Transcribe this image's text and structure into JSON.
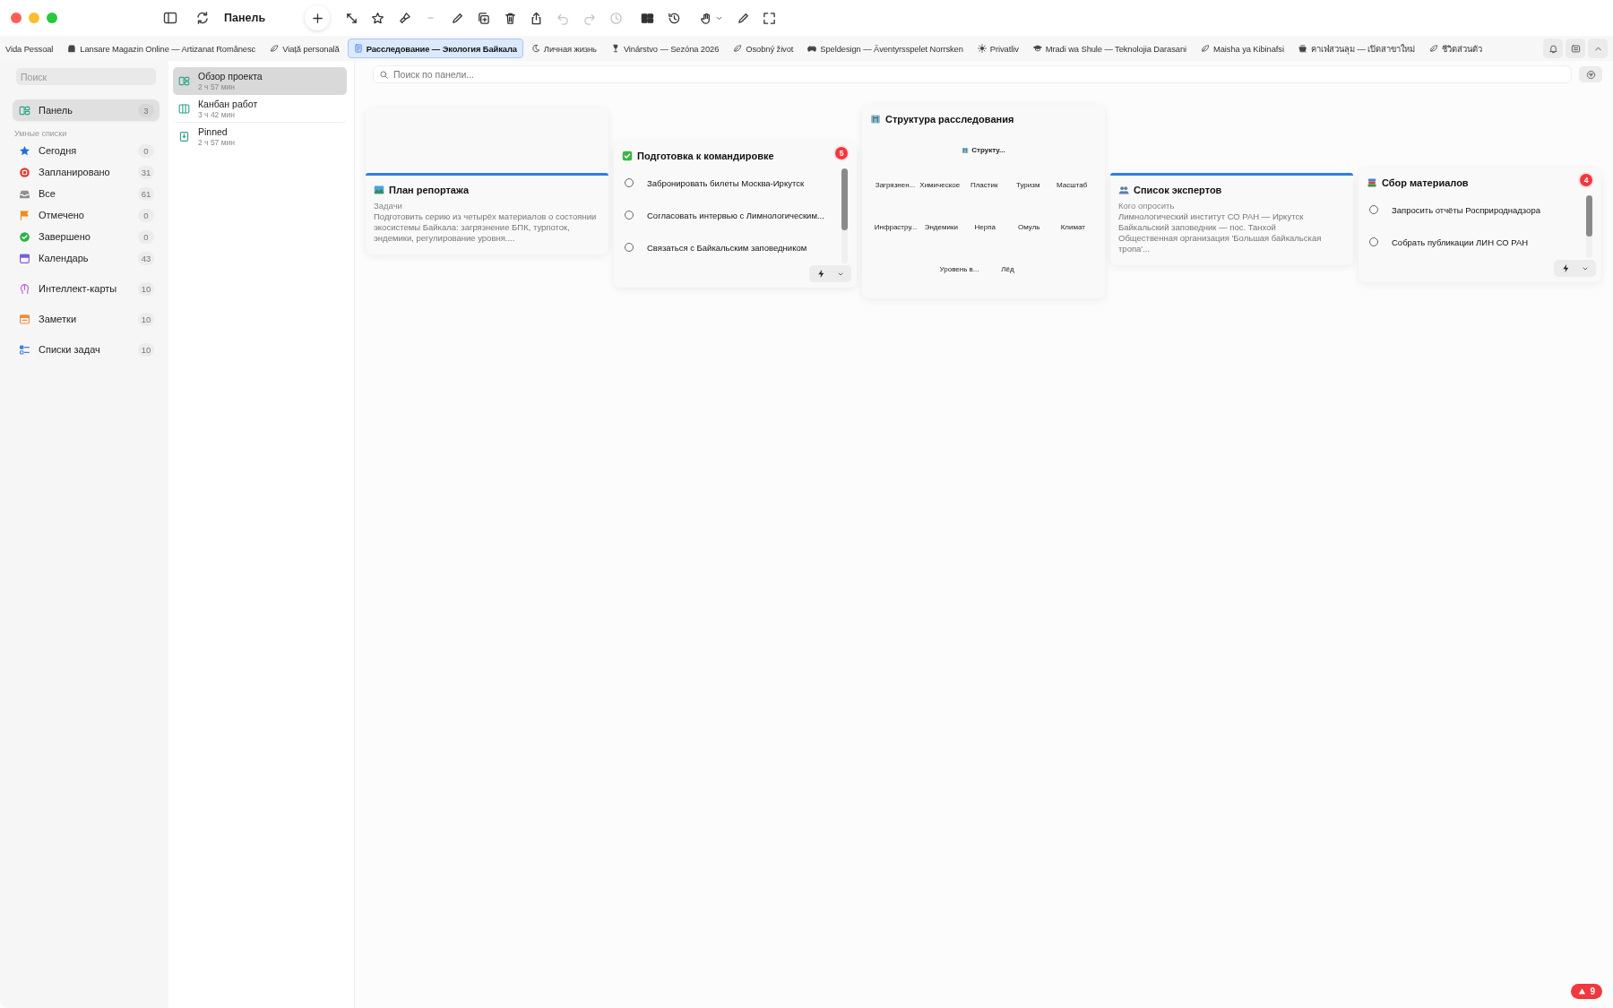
{
  "window": {
    "title": "Панель"
  },
  "toolbar_buttons": [
    {
      "disabled": false
    },
    {
      "disabled": false
    },
    {
      "disabled": false
    },
    {
      "disabled": false
    },
    {
      "disabled": true
    },
    {
      "disabled": false
    },
    {
      "disabled": false
    },
    {
      "disabled": false
    },
    {
      "disabled": false
    },
    {
      "disabled": true
    },
    {
      "disabled": true
    },
    {
      "disabled": true
    },
    {
      "disabled": false
    },
    {
      "disabled": false
    },
    {
      "disabled": false
    },
    {
      "disabled": false
    },
    {
      "disabled": false
    }
  ],
  "tabs": [
    {
      "label": "Vida Pessoal",
      "selected": false
    },
    {
      "label": "Lansare Magazin Online — Artizanat Românesc",
      "selected": false
    },
    {
      "label": "Viață personală",
      "selected": false
    },
    {
      "label": "Расследование — Экология Байкала",
      "selected": true
    },
    {
      "label": "Личная жизнь",
      "selected": false
    },
    {
      "label": "Vinárstvo — Sezóna 2026",
      "selected": false
    },
    {
      "label": "Osobný život",
      "selected": false
    },
    {
      "label": "Speldesign — Äventyrsspelet Norrsken",
      "selected": false
    },
    {
      "label": "Privatliv",
      "selected": false
    },
    {
      "label": "Mradi wa Shule — Teknolojia Darasani",
      "selected": false
    },
    {
      "label": "Maisha ya Kibinafsi",
      "selected": false
    },
    {
      "label": "คาเฟ่สวนลุม — เปิดสาขาใหม่",
      "selected": false
    },
    {
      "label": "ชีวิตส่วนตัว",
      "selected": false
    }
  ],
  "sidebar": {
    "search": {
      "placeholder": "Поиск"
    },
    "items": [
      {
        "label": "Панель",
        "count": "3",
        "selected": true
      }
    ],
    "section_title": "Умные списки",
    "smart_lists": [
      {
        "label": "Сегодня",
        "count": "0",
        "selected": false
      },
      {
        "label": "Запланировано",
        "count": "31",
        "selected": false
      },
      {
        "label": "Все",
        "count": "61",
        "selected": false
      },
      {
        "label": "Отмечено",
        "count": "0",
        "selected": false
      },
      {
        "label": "Завершено",
        "count": "0",
        "selected": false
      },
      {
        "label": "Календарь",
        "count": "43",
        "selected": false
      }
    ],
    "collections": [
      {
        "label": "Интеллект-карты",
        "count": "10",
        "selected": false
      },
      {
        "label": "Заметки",
        "count": "10",
        "selected": false
      },
      {
        "label": "Списки задач",
        "count": "10",
        "selected": false
      }
    ]
  },
  "boards": [
    {
      "title": "Обзор проекта",
      "subtitle": "2 ч 57 мин",
      "selected": true
    },
    {
      "title": "Канбан работ",
      "subtitle": "3 ч 42 мин",
      "selected": false
    },
    {
      "title": "Pinned",
      "subtitle": "2 ч 57 мин",
      "selected": false
    }
  ],
  "board_search": {
    "placeholder": "Поиск по панели..."
  },
  "cards": [
    {
      "kind": "note",
      "title": "План репортажа",
      "subtitle": "Задачи",
      "lines": [
        "Подготовить серию из четырёх материалов о состоянии экосистемы Байкала: загрязнение БПК, турпоток, эндемики, регулирование уровня...."
      ]
    },
    {
      "kind": "tasks",
      "title": "Подготовка к командировке",
      "badge": "5",
      "tasks": [
        {
          "label": "Забронировать билеты Москва-Иркутск",
          "checked": false
        },
        {
          "label": "Согласовать интервью с Лимнологическим...",
          "checked": false
        },
        {
          "label": "Связаться с Байкальским заповедником",
          "checked": false
        }
      ]
    },
    {
      "kind": "mindmap",
      "title": "Структура расследования",
      "root": "Структу...",
      "rows": [
        [
          "Загрязнен...",
          "Химическое",
          "Пластик",
          "Туризм",
          "Масштаб"
        ],
        [
          "Инфрастру...",
          "Эндемики",
          "Нерпа",
          "Омуль",
          "Климат"
        ],
        [
          "Уровень в...",
          "Лёд"
        ]
      ]
    },
    {
      "kind": "note",
      "title": "Список экспертов",
      "subtitle": "Кого опросить",
      "lines": [
        "Лимнологический институт СО РАН — Иркутск",
        "Байкальский заповедник — пос. Танхой",
        "Общественная организация 'Большая байкальская тропа'..."
      ]
    },
    {
      "kind": "tasks",
      "title": "Сбор материалов",
      "badge": "4",
      "tasks": [
        {
          "label": "Запросить отчёты Росприроднадзора",
          "checked": false
        },
        {
          "label": "Собрать публикации ЛИН СО РАН",
          "checked": false
        }
      ]
    }
  ],
  "alert_badge": {
    "count": "9"
  }
}
